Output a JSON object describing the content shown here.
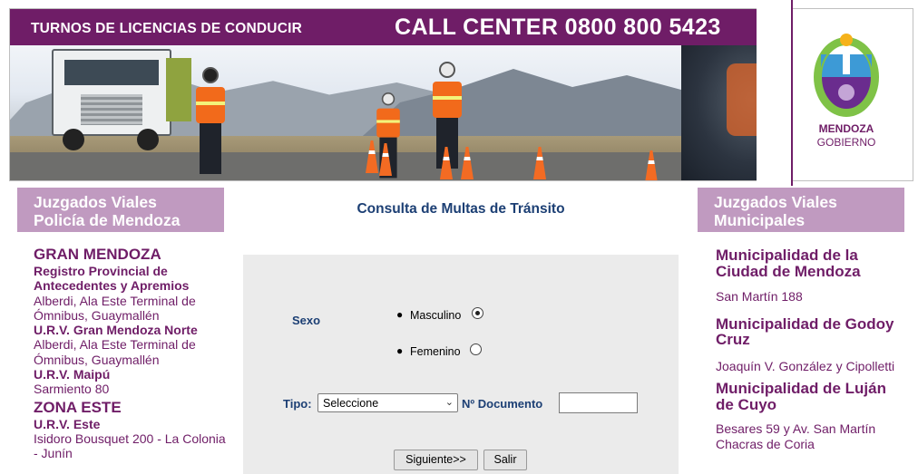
{
  "header": {
    "turnos": "TURNOS DE LICENCIAS DE CONDUCIR",
    "call_center": "CALL CENTER 0800 800 5423",
    "logo_line1": "MENDOZA",
    "logo_line2": "GOBIERNO",
    "colors": {
      "brand": "#6f1d67",
      "accent": "#c09ac0",
      "title_blue": "#1c3f74"
    }
  },
  "left": {
    "heading_line1": "Juzgados Viales",
    "heading_line2": "Policía de Mendoza",
    "zone1": "GRAN MENDOZA",
    "entries": [
      {
        "name": "Registro Provincial de Antecedentes y Apremios",
        "address": "Alberdi, Ala Este Terminal de Ómnibus, Guaymallén"
      },
      {
        "name": "U.R.V. Gran Mendoza Norte",
        "address": "Alberdi, Ala Este Terminal de Ómnibus, Guaymallén"
      },
      {
        "name": "U.R.V. Maipú",
        "address": "Sarmiento 80"
      }
    ],
    "zone2": "ZONA ESTE",
    "entries2": [
      {
        "name": "U.R.V. Este",
        "address": "Isidoro Bousquet 200 - La Colonia - Junín"
      }
    ]
  },
  "center": {
    "title": "Consulta de Multas de Tránsito",
    "sexo_label": "Sexo",
    "opt_masculino": "Masculino",
    "opt_femenino": "Femenino",
    "selected_sexo": "Masculino",
    "tipo_label": "Tipo:",
    "tipo_value": "Seleccione",
    "doc_label": "Nº Documento",
    "doc_value": "",
    "btn_next": "Siguiente>>",
    "btn_exit": "Salir"
  },
  "right": {
    "heading_line1": "Juzgados Viales",
    "heading_line2": "Municipales",
    "items": [
      {
        "name": "Municipalidad de la Ciudad de Mendoza",
        "address": "San Martín 188"
      },
      {
        "name": "Municipalidad de Godoy Cruz",
        "address": "Joaquín V. González y Cipolletti"
      },
      {
        "name": "Municipalidad de Luján de Cuyo",
        "address": "Besares 59 y Av. San Martín Chacras de Coria"
      }
    ]
  }
}
